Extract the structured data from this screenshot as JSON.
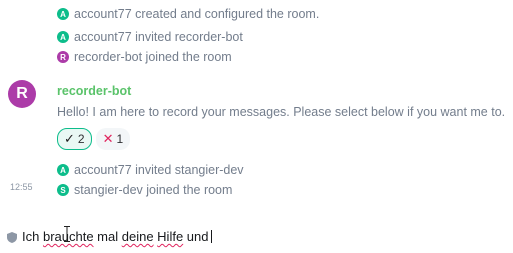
{
  "timeline": {
    "events_top": [
      {
        "avatar_letter": "A",
        "text": "account77 created and configured the room."
      },
      {
        "avatar_letter": "A",
        "text": "account77 invited recorder-bot"
      },
      {
        "avatar_letter": "R",
        "text": "recorder-bot joined the room"
      }
    ],
    "message": {
      "avatar_letter": "R",
      "sender": "recorder-bot",
      "body": "Hello! I am here to record your messages. Please select below if you want me to.",
      "reactions": [
        {
          "emoji": "✓",
          "count": "2",
          "selected": true
        },
        {
          "emoji": "✕",
          "count": "1",
          "selected": false
        }
      ]
    },
    "events_bottom": [
      {
        "avatar_letter": "A",
        "text": "account77 invited stangier-dev"
      },
      {
        "avatar_letter": "S",
        "text": "stangier-dev joined the room"
      }
    ],
    "timestamp": "12:55"
  },
  "composer": {
    "segments": [
      "Ich ",
      "brauchte",
      " mal ",
      "deine",
      " ",
      "Hilfe",
      " und"
    ]
  },
  "colors": {
    "accent": "#0dbd8b",
    "purple_avatar": "#ac3ba8",
    "sender_name": "#5ac36a",
    "spellcheck": "#e0245e"
  }
}
